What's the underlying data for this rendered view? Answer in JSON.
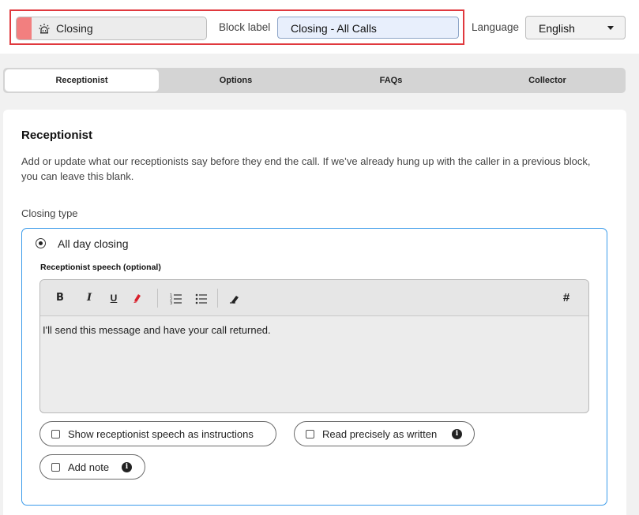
{
  "block": {
    "name": "Closing",
    "icon": "alarm-bell-icon",
    "accent_color": "#f27f7f",
    "label_caption": "Block label",
    "label_value": "Closing - All Calls"
  },
  "language": {
    "caption": "Language",
    "selected": "English"
  },
  "tabs": [
    {
      "label": "Receptionist",
      "active": true
    },
    {
      "label": "Options",
      "active": false
    },
    {
      "label": "FAQs",
      "active": false
    },
    {
      "label": "Collector",
      "active": false
    }
  ],
  "section": {
    "title": "Receptionist",
    "description": "Add or update what our receptionists say before they end the call. If we’ve already hung up with the caller in a previous block, you can leave this blank.",
    "closing_type_label": "Closing type"
  },
  "closing_option": {
    "label": "All day closing",
    "selected": true
  },
  "speech": {
    "label": "Receptionist speech (optional)",
    "text": "I'll send this message and have your call returned.",
    "toolbar": {
      "bold": "B",
      "italic": "I",
      "underline": "U",
      "hashtag": "#"
    }
  },
  "options": {
    "show_as_instructions": "Show receptionist speech as instructions",
    "read_precisely": "Read precisely as written",
    "add_note": "Add note",
    "info_glyph": "i"
  },
  "colors": {
    "highlight_border": "#e0393e",
    "focus_border": "#3b9bea",
    "input_bg": "#e8effc"
  }
}
